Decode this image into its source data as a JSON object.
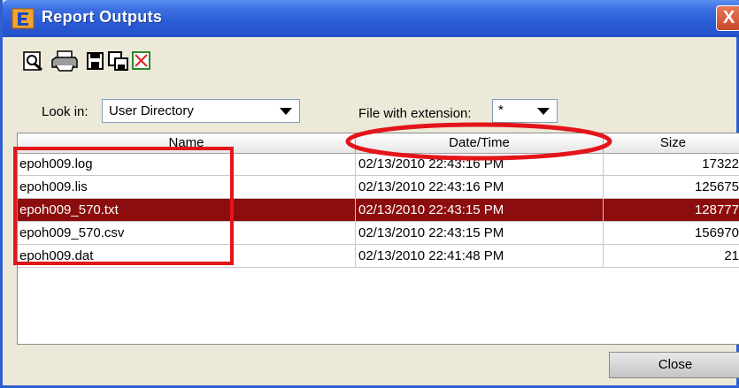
{
  "window": {
    "title": "Report Outputs",
    "close_glyph": "X"
  },
  "toolbar": {
    "buttons": [
      {
        "icon": "preview-icon"
      },
      {
        "icon": "print-icon"
      },
      {
        "icon": "save-icon"
      },
      {
        "icon": "save-as-icon"
      },
      {
        "icon": "delete-icon"
      }
    ]
  },
  "filters": {
    "look_in_label": "Look in:",
    "look_in_value": "User Directory",
    "extension_label": "File with extension:",
    "extension_value": "*"
  },
  "table": {
    "columns": [
      "Name",
      "Date/Time",
      "Size"
    ],
    "rows": [
      {
        "name": "epoh009.log",
        "datetime": "02/13/2010 22:43:16 PM",
        "size": "17322",
        "selected": false
      },
      {
        "name": "epoh009.lis",
        "datetime": "02/13/2010 22:43:16 PM",
        "size": "125675",
        "selected": false
      },
      {
        "name": "epoh009_570.txt",
        "datetime": "02/13/2010 22:43:15 PM",
        "size": "128777",
        "selected": true
      },
      {
        "name": "epoh009_570.csv",
        "datetime": "02/13/2010 22:43:15 PM",
        "size": "156970",
        "selected": false
      },
      {
        "name": "epoh009.dat",
        "datetime": "02/13/2010 22:41:48 PM",
        "size": "21",
        "selected": false
      }
    ]
  },
  "footer": {
    "close_label": "Close"
  },
  "colors": {
    "titlebar": "#2a5bd6",
    "selection": "#8b0d0d",
    "annotation": "#e3151a"
  }
}
